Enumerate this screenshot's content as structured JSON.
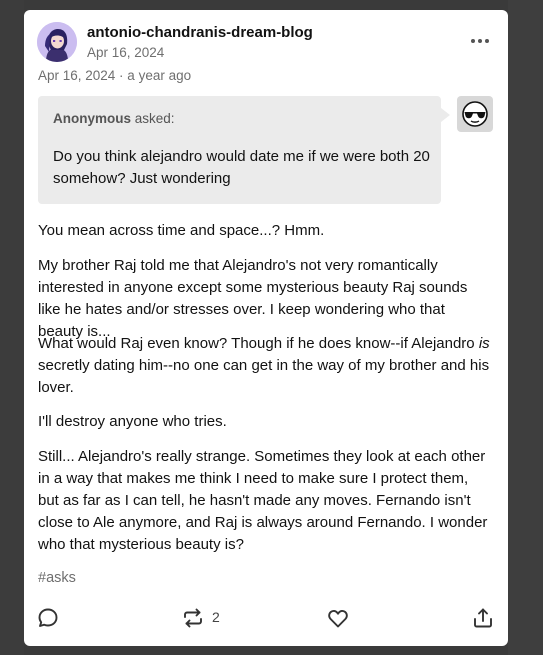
{
  "post": {
    "blog_name": "antonio-chandranis-dream-blog",
    "blog_date": "Apr 16, 2024",
    "post_meta": "Apr 16, 2024 · a year ago",
    "ask": {
      "asker": "Anonymous",
      "asked_label": "asked:",
      "question": "Do you think alejandro would date me if we were both 20 somehow? Just wondering"
    },
    "paragraphs": {
      "p1": "You mean across time and space...? Hmm.",
      "p2": "My brother Raj told me that Alejandro's not very romantically interested in anyone except some mysterious beauty Raj sounds like he hates and/or stresses over. I keep wondering who that beauty is...",
      "p3_before": "What would Raj even know? Though if he does know--if Alejandro ",
      "p3_em": "is",
      "p3_after": " secretly dating him--no one can get in the way of my brother and his lover.",
      "p4": "I'll destroy anyone who tries.",
      "p5": "Still... Alejandro's really strange. Sometimes they look at each other in a way that makes me think I need to make sure I protect them, but as far as I can tell, he hasn't made any moves. Fernando isn't close to Ale anymore, and Raj is always around Fernando. I wonder who that mysterious beauty is?"
    },
    "tags": [
      "#asks"
    ],
    "reblog_count": "2"
  },
  "icons": {
    "more": "more-horizontal-icon",
    "reply": "reply-bubble-icon",
    "reblog": "reblog-icon",
    "like": "heart-icon",
    "share": "share-icon"
  }
}
